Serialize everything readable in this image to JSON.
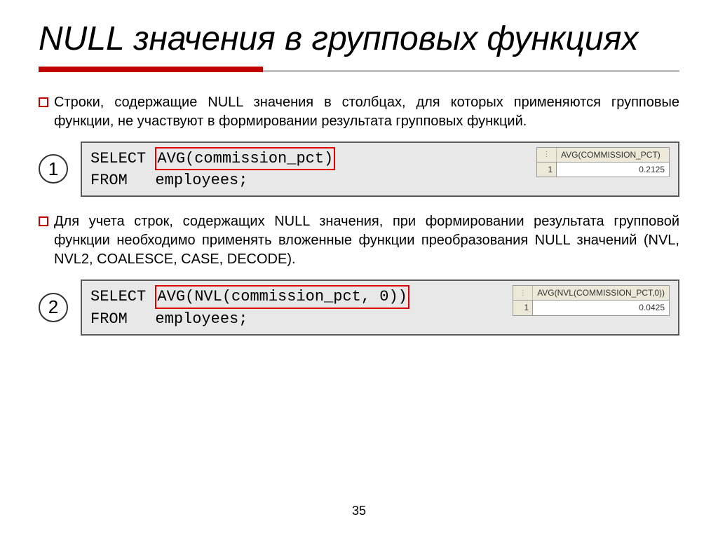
{
  "slide": {
    "title": "NULL значения в групповых функциях",
    "bullet1": "Строки, содержащие NULL значения в столбцах, для которых применяются групповые функции, не участвуют в формировании результата групповых функций.",
    "bullet2": "Для учета строк, содержащих NULL значения, при формировании результата групповой функции необходимо применять вложенные функции преобразования NULL значений (NVL, NVL2, COALESCE, CASE, DECODE).",
    "page_number": "35"
  },
  "examples": [
    {
      "num": "1",
      "code_prefix": "SELECT ",
      "code_highlight": "AVG(commission_pct)",
      "code_suffix": "\nFROM   employees;",
      "result_header": "AVG(COMMISSION_PCT)",
      "result_row_idx": "1",
      "result_value": "0.2125"
    },
    {
      "num": "2",
      "code_prefix": "SELECT ",
      "code_highlight": "AVG(NVL(commission_pct, 0))",
      "code_suffix": "\nFROM   employees;",
      "result_header": "AVG(NVL(COMMISSION_PCT,0))",
      "result_row_idx": "1",
      "result_value": "0.0425"
    }
  ]
}
